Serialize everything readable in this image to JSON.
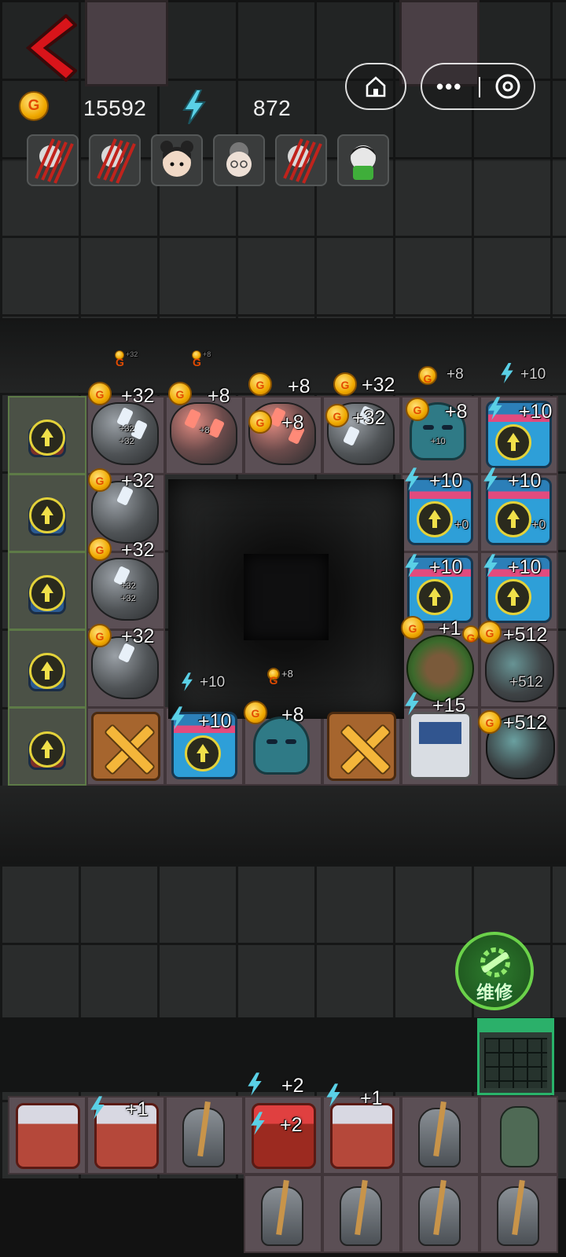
{
  "resources": {
    "coins": "15592",
    "energy": "872"
  },
  "capsule": {
    "home_icon": "home-icon",
    "more_icon": "more-dots-icon",
    "close_icon": "close-circle-icon"
  },
  "portraits": [
    {
      "name": "portrait-clawed-1"
    },
    {
      "name": "portrait-clawed-2"
    },
    {
      "name": "portrait-girl-buns"
    },
    {
      "name": "portrait-old-woman"
    },
    {
      "name": "portrait-clawed-3"
    },
    {
      "name": "portrait-green-boy"
    }
  ],
  "faint_gains": [
    "+32",
    "+8"
  ],
  "board_gains": {
    "row_top_header": [
      "+32",
      "+8",
      "+8",
      "+32",
      "+8",
      "+10"
    ],
    "r1": [
      "+32",
      "+8",
      "+32",
      "+8",
      "+10"
    ],
    "r1_inner": [
      "+8"
    ],
    "r2": [
      "+32",
      "+10",
      "+10"
    ],
    "r3": [
      "+32",
      "+10",
      "+10"
    ],
    "r4": [
      "+32",
      "+1",
      "+512"
    ],
    "r4_inner": [
      "+512"
    ],
    "pit": [
      "+10",
      "+8"
    ],
    "r5": [
      "+10",
      "+8",
      "+15",
      "+512"
    ],
    "tiny": [
      "+32",
      "+32",
      "+8",
      "+32",
      "+32",
      "+10",
      "+0",
      "+0"
    ]
  },
  "repair_button": {
    "label": "维修"
  },
  "shelf_gains": [
    "+1",
    "+2",
    "+2",
    "+1"
  ],
  "colors": {
    "accent_gold": "#f0a800",
    "energy_blue": "#3ec6e0",
    "repair_green": "#2e7d2e"
  }
}
